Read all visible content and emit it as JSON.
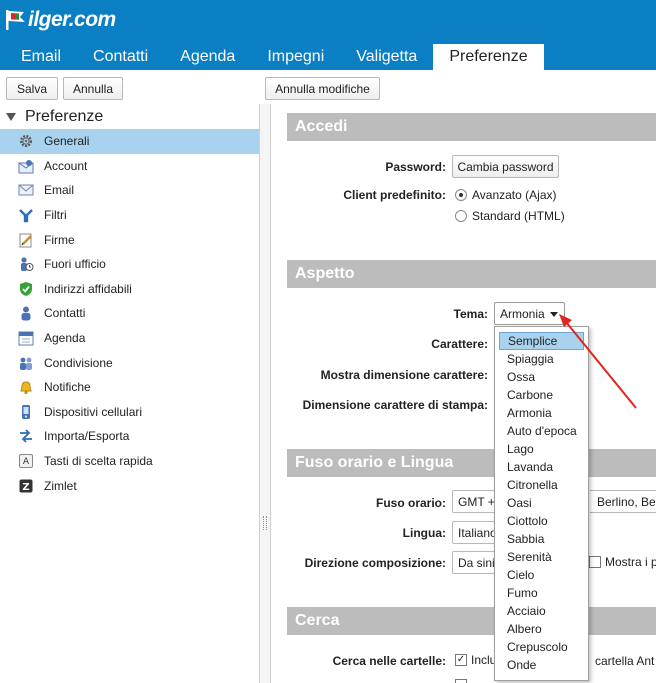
{
  "brand": {
    "logo_text": "ilger.com"
  },
  "tabs": [
    {
      "label": "Email"
    },
    {
      "label": "Contatti"
    },
    {
      "label": "Agenda"
    },
    {
      "label": "Impegni"
    },
    {
      "label": "Valigetta"
    },
    {
      "label": "Preferenze",
      "active": true
    }
  ],
  "toolbar": {
    "save_label": "Salva",
    "cancel_label": "Annulla",
    "undo_label": "Annulla modifiche"
  },
  "sidebar": {
    "title": "Preferenze",
    "items": [
      {
        "label": "Generali",
        "icon": "gear-icon",
        "selected": true
      },
      {
        "label": "Account",
        "icon": "account-icon"
      },
      {
        "label": "Email",
        "icon": "envelope-icon"
      },
      {
        "label": "Filtri",
        "icon": "filter-icon"
      },
      {
        "label": "Firme",
        "icon": "signature-icon"
      },
      {
        "label": "Fuori ufficio",
        "icon": "out-of-office-icon"
      },
      {
        "label": "Indirizzi affidabili",
        "icon": "shield-check-icon"
      },
      {
        "label": "Contatti",
        "icon": "contact-icon"
      },
      {
        "label": "Agenda",
        "icon": "calendar-icon"
      },
      {
        "label": "Condivisione",
        "icon": "share-icon"
      },
      {
        "label": "Notifiche",
        "icon": "bell-icon"
      },
      {
        "label": "Dispositivi cellulari",
        "icon": "mobile-icon"
      },
      {
        "label": "Importa/Esporta",
        "icon": "import-export-icon"
      },
      {
        "label": "Tasti di scelta rapida",
        "icon": "keyboard-icon"
      },
      {
        "label": "Zimlet",
        "icon": "zimlet-icon"
      }
    ]
  },
  "sections": {
    "accedi": "Accedi",
    "aspetto": "Aspetto",
    "fuso": "Fuso orario e Lingua",
    "cerca": "Cerca"
  },
  "accedi": {
    "password_label": "Password:",
    "password_button": "Cambia password",
    "client_label": "Client predefinito:",
    "client_options": [
      {
        "label": "Avanzato (Ajax)",
        "checked": true
      },
      {
        "label": "Standard (HTML)",
        "checked": false
      }
    ]
  },
  "aspetto": {
    "tema_label": "Tema:",
    "tema_value": "Armonia",
    "carattere_label": "Carattere:",
    "mostra_dim_label": "Mostra dimensione carattere:",
    "dim_stampa_label": "Dimensione carattere di stampa:",
    "tema_options": [
      "Semplice",
      "Spiaggia",
      "Ossa",
      "Carbone",
      "Armonia",
      "Auto d'epoca",
      "Lago",
      "Lavanda",
      "Citronella",
      "Oasi",
      "Ciottolo",
      "Sabbia",
      "Serenità",
      "Cielo",
      "Fumo",
      "Acciaio",
      "Albero",
      "Crepuscolo",
      "Onde"
    ],
    "highlighted_option": "Semplice"
  },
  "fuso": {
    "fuso_label": "Fuso orario:",
    "fuso_value_left": "GMT +",
    "fuso_value_right": "Berlino, Be",
    "lingua_label": "Lingua:",
    "lingua_value": "Italiano",
    "direzione_label": "Direzione composizione:",
    "direzione_value": "Da sini",
    "mostra_label": "Mostra i pu"
  },
  "cerca": {
    "cartelle_label": "Cerca nelle cartelle:",
    "cartelle_left": "Inclu",
    "cartelle_right": "cartella Ant",
    "checked": true
  },
  "colors": {
    "header_bg": "#0a7fc4",
    "selected_bg": "#a9d2ef",
    "section_bg": "#bcbcbc",
    "annotation_arrow": "#e0261f"
  }
}
